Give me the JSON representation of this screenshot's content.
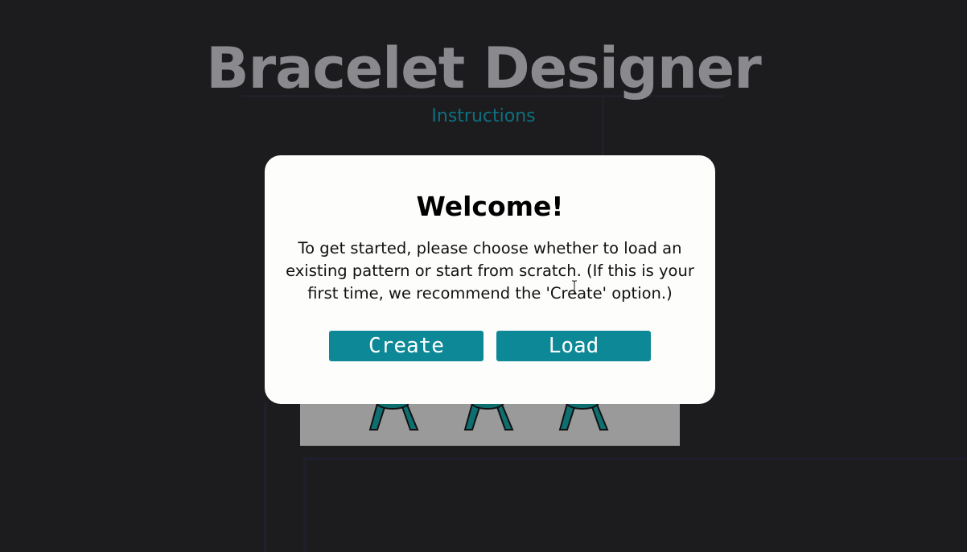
{
  "app": {
    "title": "Bracelet Designer",
    "instructions_link": "Instructions"
  },
  "modal": {
    "title": "Welcome!",
    "message": "To get started, please choose whether to load an existing pattern or start from scratch. (If this is your first time, we recommend the 'Create' option.)",
    "create_label": "Create",
    "load_label": "Load"
  },
  "icons": {
    "cursor": "text-cursor-icon",
    "tassel": "tassel-icon"
  },
  "colors": {
    "background": "#1c1c1e",
    "accent": "#0d8896",
    "link": "#0d7080",
    "modal_bg": "#fdfdfc"
  }
}
